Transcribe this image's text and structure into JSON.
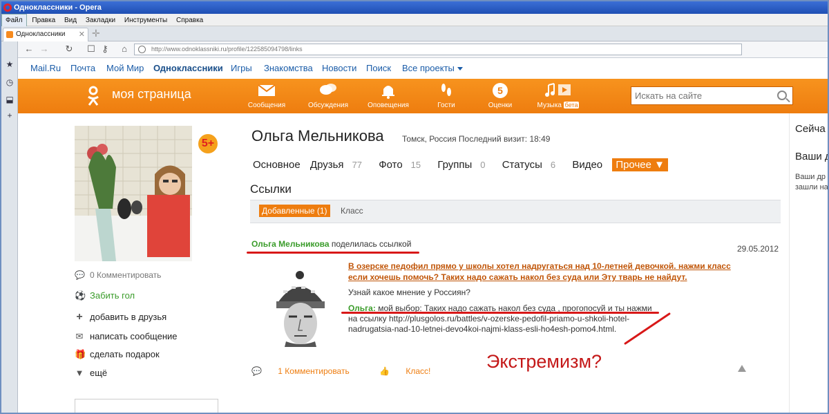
{
  "window": {
    "title": "Одноклассники - Opera"
  },
  "menu": [
    "Файл",
    "Правка",
    "Вид",
    "Закладки",
    "Инструменты",
    "Справка"
  ],
  "tab": {
    "label": "Одноклассники"
  },
  "address": {
    "url": "http://www.odnoklassniki.ru/profile/122585094798/links"
  },
  "topnav": {
    "items": [
      "Mail.Ru",
      "Почта",
      "Мой Мир",
      "Одноклассники",
      "Игры",
      "Знакомства",
      "Новости",
      "Поиск",
      "Все проекты"
    ]
  },
  "header": {
    "title": "моя страница",
    "items": [
      "Сообщения",
      "Обсуждения",
      "Оповещения",
      "Гости",
      "Оценки",
      "Музыка"
    ],
    "beta_label": "бета",
    "search_placeholder": "Искать на сайте"
  },
  "profile": {
    "badge": "5+",
    "name": "Ольга Мельникова",
    "meta": "Томск, Россия Последний визит: 18:49",
    "photo_comments": "0 Комментировать",
    "links": [
      "Забить гол",
      "добавить в друзья",
      "написать сообщение",
      "сделать подарок",
      "ещё"
    ]
  },
  "profile_tabs": {
    "main": "Основное",
    "friends": "Друзья",
    "friends_count": "77",
    "photo": "Фото",
    "photo_count": "15",
    "groups": "Группы",
    "groups_count": "0",
    "statuses": "Статусы",
    "statuses_count": "6",
    "video": "Видео",
    "more": "Прочее ▼"
  },
  "section": {
    "title": "Ссылки",
    "active_tab": "Добавленные (1)",
    "other_tab": "Класс"
  },
  "post": {
    "author": "Ольга Мельникова",
    "action": "поделилась ссылкой",
    "date": "29.05.2012",
    "headline": "В озерске педофил прямо у школы хотел надругаться над 10-летней девочкой. нажми класс если хочешь помочь? Таких надо сажать накол без суда или Эту тварь не найдут.",
    "ask": "Узнай какое мнение у Россиян?",
    "quote_author": "Ольга",
    "quote_text": "мой выбор: Таких надо сажать накол без суда , прогопосуй и ты нажми на ссылку http://plusgolos.ru/battles/v-ozerske-pedofil-priamo-u-shkoli-hotel-nadrugatsia-nad-10-letnei-devo4koi-najmi-klass-esli-ho4esh-pomo4.html.",
    "comments": "1 Комментировать",
    "like": "Класс!"
  },
  "annotation": {
    "text": "Экстремизм?"
  },
  "right": {
    "line1": "Сейча",
    "line2": "Ваши д",
    "line3": "Ваши др",
    "line4": "зашли на"
  },
  "colors": {
    "orange": "#ee7d0f",
    "green": "#3a9c2a",
    "link_blue": "#1a5ca8",
    "annotation_red": "#d81818"
  }
}
